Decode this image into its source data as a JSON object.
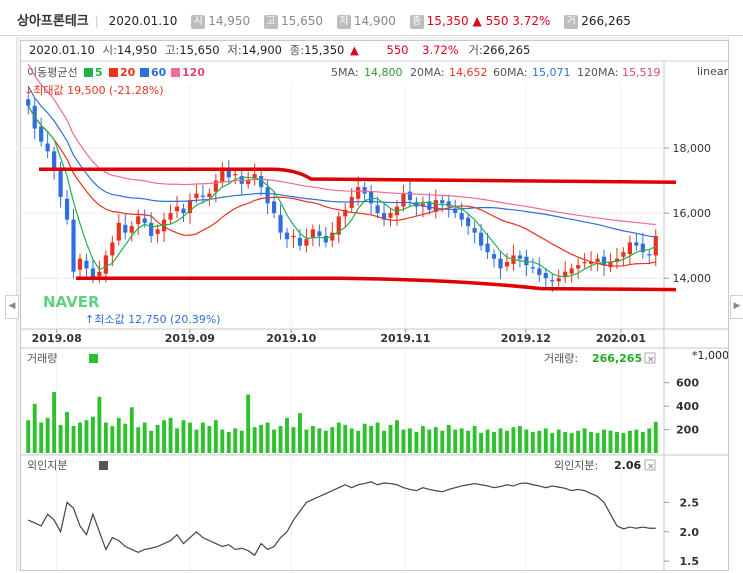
{
  "header": {
    "name": "상아프론테크",
    "date": "2020.01.10",
    "open_tag": "시",
    "open": "14,950",
    "high_tag": "고",
    "high": "15,650",
    "low_tag": "저",
    "low": "14,900",
    "close_tag": "종",
    "close": "15,350",
    "change_arrow": "▲",
    "change": "550",
    "change_pct": "3.72%",
    "volume_tag": "거",
    "volume": "266,265"
  },
  "info_line": {
    "date": "2020.01.10",
    "open_label": "시:",
    "open": "14,950",
    "high_label": "고:",
    "high": "15,650",
    "low_label": "저:",
    "low": "14,900",
    "close_label": "종:",
    "close": "15,350",
    "arrow": "▲",
    "change": "550",
    "change_pct": "3.72%",
    "volume_label": "거:",
    "volume": "266,265"
  },
  "ma_legend": {
    "title": "이동평균선",
    "items": [
      {
        "label": "5",
        "color": "#22b14c"
      },
      {
        "label": "20",
        "color": "#e8321e"
      },
      {
        "label": "60",
        "color": "#2f6fdd"
      },
      {
        "label": "120",
        "color": "#f06a9a"
      }
    ],
    "values": [
      {
        "label": "5MA:",
        "value": "14,800",
        "color": "#2a9d2a"
      },
      {
        "label": "20MA:",
        "value": "14,652",
        "color": "#e8321e"
      },
      {
        "label": "60MA:",
        "value": "15,071",
        "color": "#2f6fdd"
      },
      {
        "label": "120MA:",
        "value": "15,519",
        "color": "#e0457a"
      }
    ]
  },
  "scale_mode": "linear",
  "max_label": "최대값 19,500 (-21.28%)",
  "min_label": "최소값 12,750 (20.39%)",
  "watermark": "NAVER",
  "volume_panel": {
    "title": "거래량",
    "legend_label": "거래량:",
    "value": "266,265",
    "unit": "*1,000",
    "color": "#2dc22d"
  },
  "foreign_panel": {
    "title": "외인지분",
    "legend_label": "외인지분:",
    "value": "2.06",
    "color": "#555555"
  },
  "colors": {
    "up": "#e8321e",
    "down": "#2f6fdd",
    "volume": "#2dc22d",
    "support": "#e00000",
    "line": "#444444"
  },
  "chart_data": [
    {
      "type": "candlestick",
      "title": "상아프론테크",
      "x_ticks": [
        "2019.08",
        "2019.09",
        "2019.10",
        "2019.11",
        "2019.12",
        "2020.01"
      ],
      "y_ticks": [
        14000,
        16000,
        18000
      ],
      "ylim": [
        12500,
        20000
      ],
      "series": [
        {
          "name": "5MA",
          "current": 14800
        },
        {
          "name": "20MA",
          "current": 14652
        },
        {
          "name": "60MA",
          "current": 15071
        },
        {
          "name": "120MA",
          "current": 15519
        }
      ],
      "closes": [
        19300,
        18600,
        18200,
        17900,
        17300,
        16500,
        15800,
        14200,
        14600,
        14300,
        14000,
        14200,
        14700,
        15100,
        15700,
        15400,
        15600,
        15900,
        15700,
        15300,
        15500,
        15800,
        16000,
        16200,
        16000,
        16400,
        16600,
        16500,
        16600,
        17000,
        17300,
        17100,
        17200,
        16900,
        17000,
        17200,
        16800,
        16300,
        16000,
        15400,
        15200,
        15300,
        15000,
        15200,
        15500,
        15300,
        15100,
        15400,
        15900,
        16100,
        16500,
        16800,
        16600,
        16300,
        16000,
        15800,
        16000,
        16200,
        16600,
        16400,
        16200,
        16300,
        16100,
        16400,
        16300,
        16200,
        16000,
        15800,
        15600,
        15400,
        15000,
        14800,
        14600,
        14300,
        14500,
        14700,
        14600,
        14400,
        14300,
        14100,
        14000,
        13900,
        14000,
        14200,
        14300,
        14400,
        14500,
        14500,
        14600,
        14400,
        14500,
        14600,
        14800,
        15100,
        15000,
        14800,
        14700,
        15300
      ],
      "max": {
        "value": 19500,
        "change_pct": -21.28
      },
      "min": {
        "value": 12750,
        "change_pct": 20.39
      }
    },
    {
      "type": "bar",
      "title": "거래량",
      "y_ticks": [
        200,
        400,
        600
      ],
      "unit": "*1,000",
      "values": [
        280,
        420,
        260,
        300,
        520,
        240,
        350,
        230,
        260,
        280,
        310,
        480,
        260,
        230,
        300,
        250,
        390,
        220,
        260,
        190,
        240,
        280,
        300,
        210,
        280,
        260,
        200,
        260,
        230,
        280,
        200,
        180,
        210,
        190,
        500,
        220,
        240,
        260,
        200,
        230,
        300,
        220,
        340,
        200,
        230,
        210,
        190,
        220,
        260,
        240,
        210,
        190,
        250,
        230,
        260,
        190,
        240,
        280,
        200,
        210,
        180,
        230,
        200,
        220,
        190,
        240,
        200,
        210,
        190,
        230,
        170,
        200,
        180,
        210,
        190,
        220,
        230,
        200,
        180,
        190,
        210,
        170,
        200,
        180,
        170,
        190,
        210,
        180,
        170,
        200,
        190,
        180,
        170,
        190,
        200,
        180,
        210,
        266
      ]
    },
    {
      "type": "line",
      "title": "외인지분",
      "y_ticks": [
        1.5,
        2.0,
        2.5
      ],
      "values": [
        2.2,
        2.15,
        2.1,
        2.3,
        2.2,
        2.0,
        2.5,
        2.4,
        2.1,
        1.95,
        2.3,
        2.0,
        1.7,
        1.9,
        1.85,
        1.75,
        1.7,
        1.65,
        1.7,
        1.72,
        1.75,
        1.8,
        1.85,
        1.95,
        1.8,
        1.9,
        2.0,
        1.9,
        1.85,
        1.8,
        1.75,
        1.78,
        1.7,
        1.72,
        1.68,
        1.6,
        1.8,
        1.7,
        1.75,
        1.9,
        2.0,
        2.2,
        2.35,
        2.5,
        2.55,
        2.6,
        2.65,
        2.7,
        2.75,
        2.8,
        2.75,
        2.8,
        2.82,
        2.85,
        2.8,
        2.83,
        2.82,
        2.8,
        2.75,
        2.72,
        2.7,
        2.75,
        2.72,
        2.7,
        2.68,
        2.72,
        2.75,
        2.78,
        2.8,
        2.82,
        2.8,
        2.78,
        2.75,
        2.77,
        2.8,
        2.78,
        2.82,
        2.83,
        2.8,
        2.78,
        2.75,
        2.78,
        2.76,
        2.74,
        2.7,
        2.72,
        2.7,
        2.65,
        2.6,
        2.5,
        2.3,
        2.1,
        2.05,
        2.08,
        2.06,
        2.08,
        2.06,
        2.06
      ]
    }
  ]
}
